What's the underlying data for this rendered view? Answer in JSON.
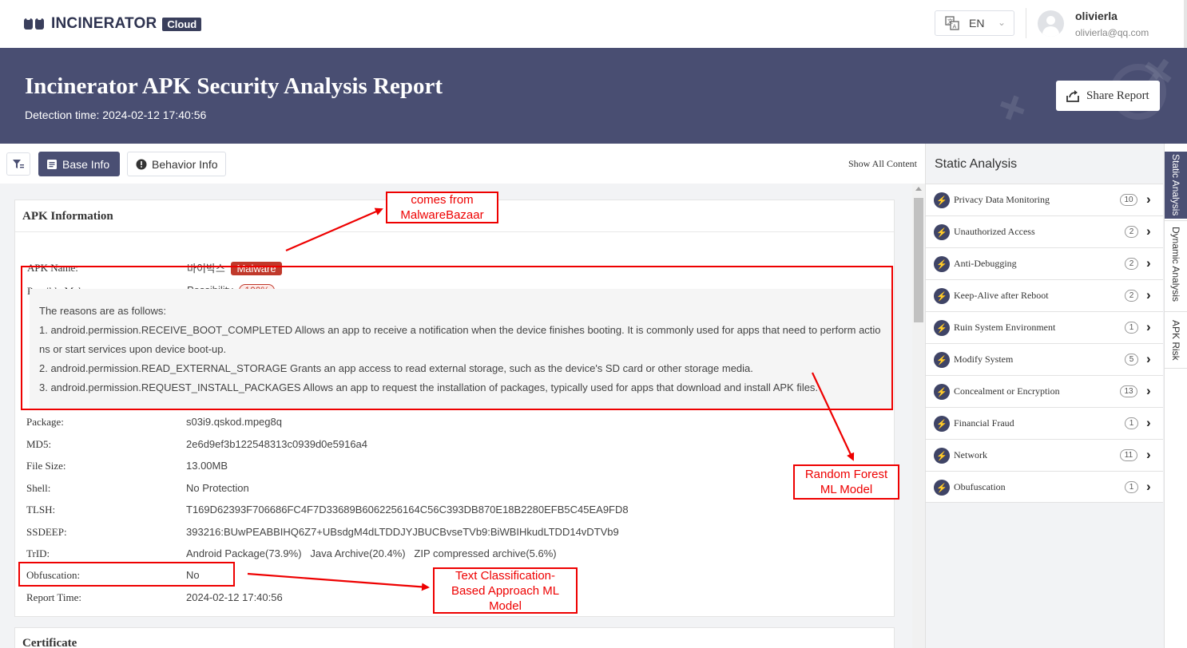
{
  "header": {
    "logo_text": "INCINERATOR",
    "logo_badge": "Cloud",
    "language": "EN",
    "user_name": "olivierla",
    "user_email": "olivierla@qq.com"
  },
  "banner": {
    "title": "Incinerator APK Security Analysis Report",
    "detection_time": "Detection time: 2024-02-12 17:40:56",
    "share_label": "Share Report"
  },
  "toolbar": {
    "tab_base": "Base Info",
    "tab_behavior": "Behavior Info",
    "show_all": "Show All Content"
  },
  "apk_info": {
    "title": "APK Information",
    "apk_name_label": "APK Name:",
    "apk_name": "바이박스",
    "malware_badge": "Malware",
    "possible_label": "Possible Malware:",
    "possibility_text": "Possibility",
    "possibility_pct": "100%",
    "reasons_header": "The reasons are as follows:",
    "reason1_a": "1. android.permission.RECEIVE_BOOT_COMPLETED Allows an app to receive a notification when the device finishes booting. It is commonly used for apps that need to perform actio",
    "reason1_b": "ns or start services upon device boot-up.",
    "reason2": "2. android.permission.READ_EXTERNAL_STORAGE Grants an app access to read external storage, such as the device's SD card or other storage media.",
    "reason3": "3. android.permission.REQUEST_INSTALL_PACKAGES Allows an app to request the installation of packages, typically used for apps that download and install APK files.",
    "rows": [
      {
        "label": "Package:",
        "value": "s03i9.qskod.mpeg8q"
      },
      {
        "label": "MD5:",
        "value": "2e6d9ef3b122548313c0939d0e5916a4"
      },
      {
        "label": "File Size:",
        "value": "13.00MB"
      },
      {
        "label": "Shell:",
        "value": "No Protection"
      },
      {
        "label": "TLSH:",
        "value": "T169D62393F706686FC4F7D33689B6062256164C56C393DB870E18B2280EFB5C45EA9FD8"
      },
      {
        "label": "SSDEEP:",
        "value": "393216:BUwPEABBIHQ6Z7+UBsdgM4dLTDDJYJBUCBvseTVb9:BiWBIHkudLTDD14vDTVb9"
      },
      {
        "label": "TrID:",
        "value": "Android Package(73.9%)   Java Archive(20.4%)   ZIP compressed archive(5.6%)"
      },
      {
        "label": "Obfuscation:",
        "value": "No"
      },
      {
        "label": "Report Time:",
        "value": "2024-02-12 17:40:56"
      }
    ]
  },
  "certificate": {
    "title": "Certificate"
  },
  "annotations": {
    "malwarebazaar_1": "comes from",
    "malwarebazaar_2": "MalwareBazaar",
    "random_forest_1": "Random Forest",
    "random_forest_2": "ML Model",
    "text_class_1": "Text Classification-",
    "text_class_2": "Based Approach ML",
    "text_class_3": "Model",
    "color": "#ee0000"
  },
  "static_analysis": {
    "title": "Static Analysis",
    "items": [
      {
        "label": "Privacy Data Monitoring",
        "count": "10"
      },
      {
        "label": "Unauthorized Access",
        "count": "2"
      },
      {
        "label": "Anti-Debugging",
        "count": "2"
      },
      {
        "label": "Keep-Alive after Reboot",
        "count": "2"
      },
      {
        "label": "Ruin System Environment",
        "count": "1"
      },
      {
        "label": "Modify System",
        "count": "5"
      },
      {
        "label": "Concealment or Encryption",
        "count": "13"
      },
      {
        "label": "Financial Fraud",
        "count": "1"
      },
      {
        "label": "Network",
        "count": "11"
      },
      {
        "label": "Obufuscation",
        "count": "1"
      }
    ]
  },
  "vertical_tabs": {
    "static": "Static Analysis",
    "dynamic": "Dynamic Analysis",
    "risk": "APK Risk"
  },
  "colors": {
    "brand": "#494e72",
    "tab_active": "#4a4f73",
    "malware_badge": "#c0392b"
  }
}
